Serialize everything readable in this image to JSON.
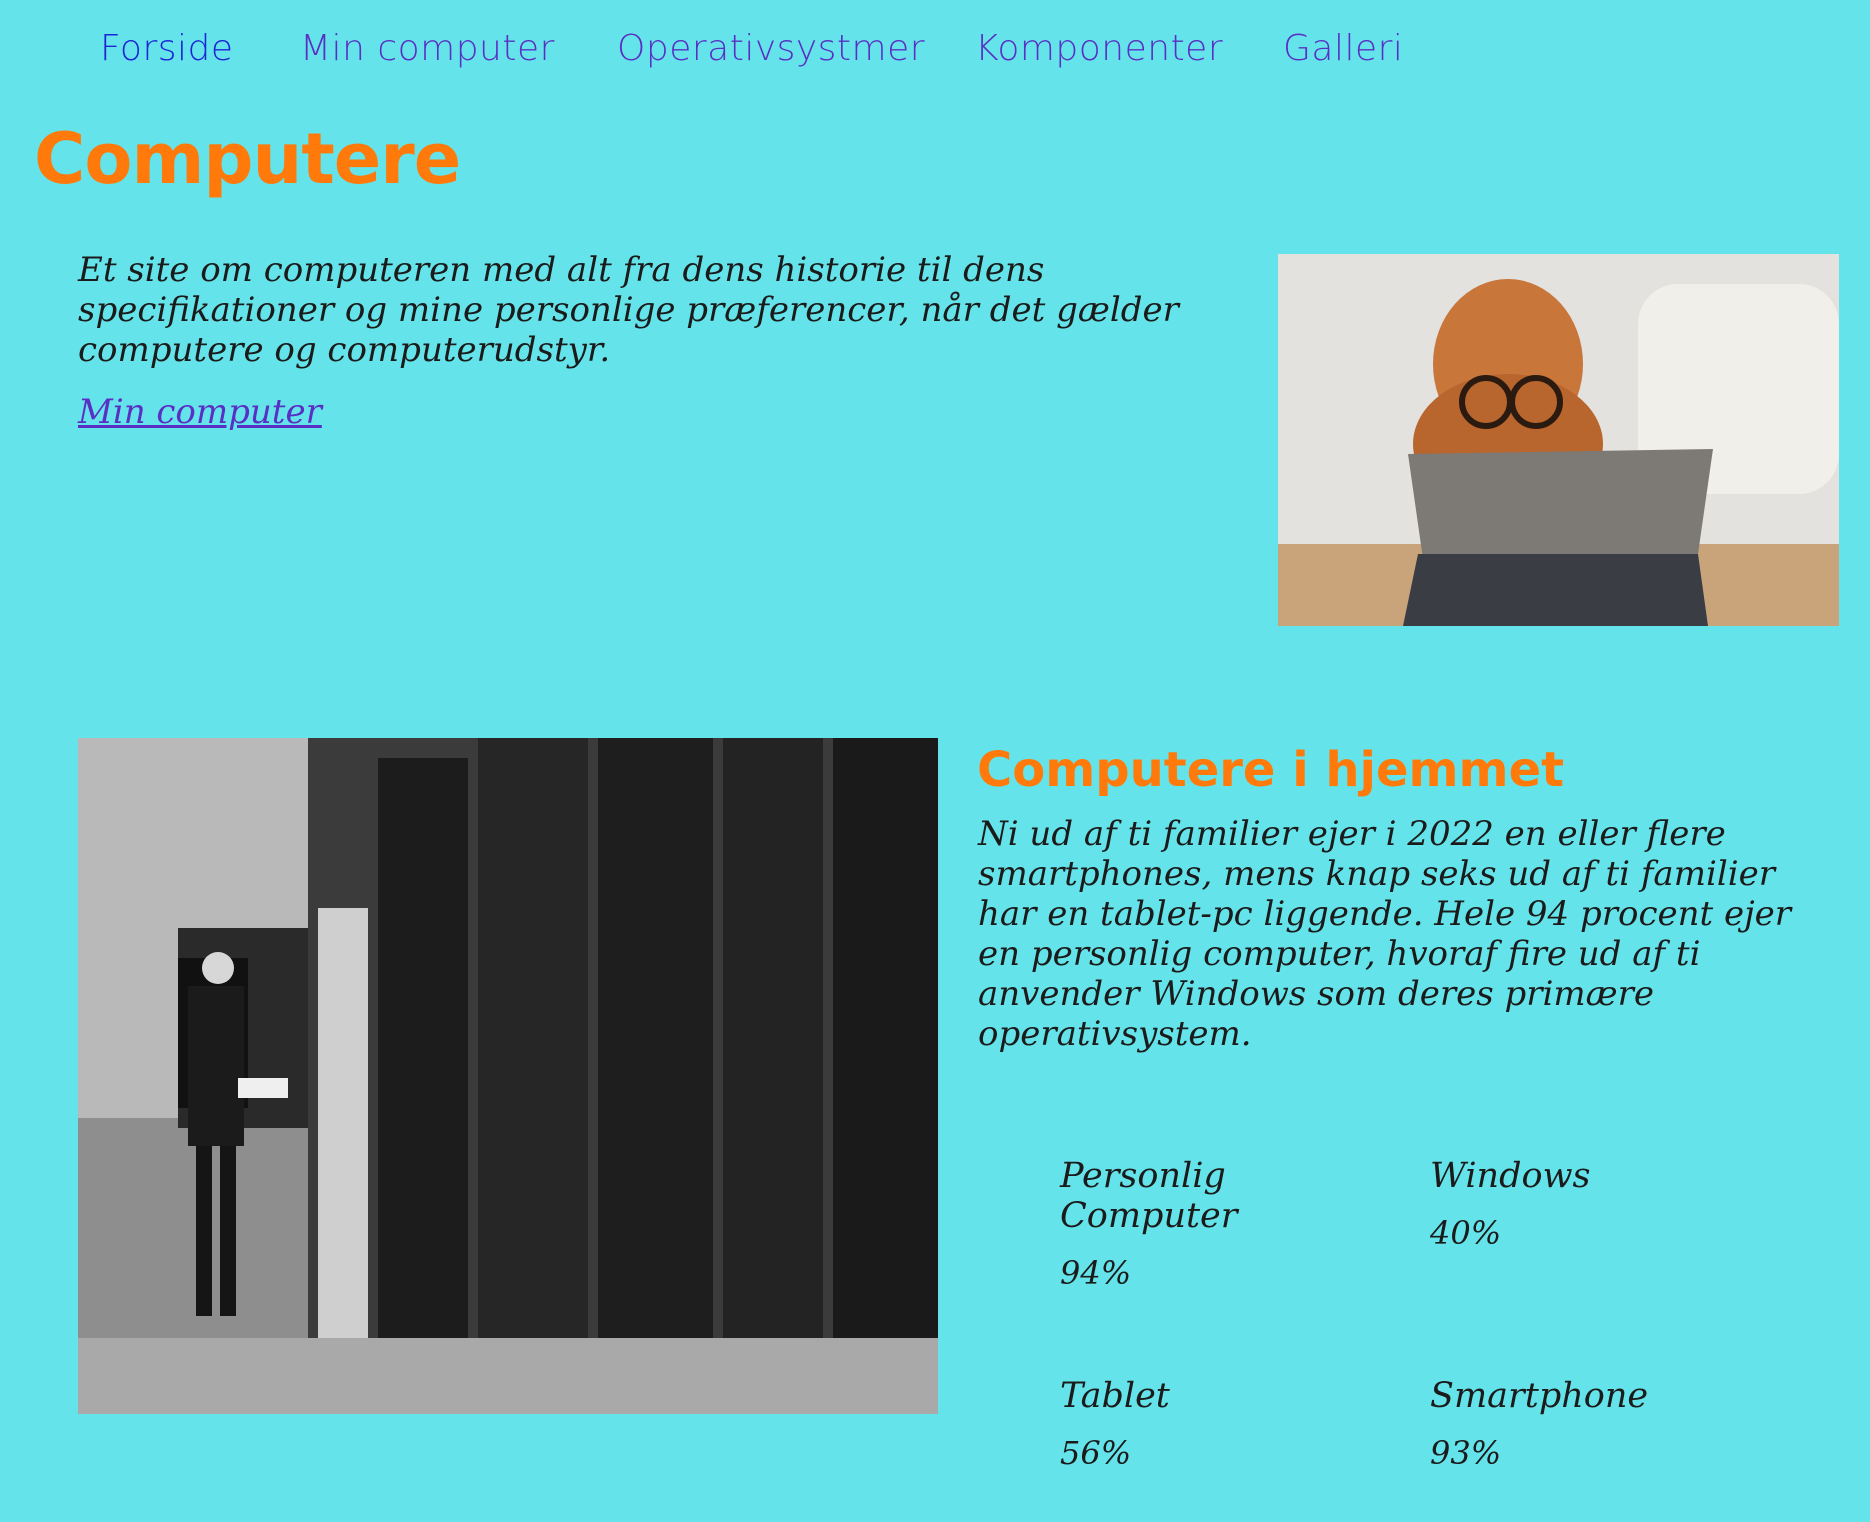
{
  "nav": {
    "items": [
      {
        "label": "Forside"
      },
      {
        "label": "Min computer"
      },
      {
        "label": "Operativsystmer"
      },
      {
        "label": "Komponenter"
      },
      {
        "label": "Galleri"
      }
    ]
  },
  "hero": {
    "title": "Computere",
    "intro": "Et site om computeren med alt fra dens historie til dens specifikationer og mine personlige præferencer, når det gælder computere og computerudstyr.",
    "link_label": "Min computer"
  },
  "home_section": {
    "title": "Computere i hjemmet",
    "text": "Ni ud af ti familier ejer i 2022 en eller flere smartphones, mens knap seks ud af ti familier har en tablet-pc liggende. Hele 94 procent ejer en personlig computer, hvoraf fire ud af ti anvender Windows som deres primære operativsystem.",
    "stats": [
      {
        "label": "Personlig Computer",
        "value": "94%"
      },
      {
        "label": "Windows",
        "value": "40%"
      },
      {
        "label": "Tablet",
        "value": "56%"
      },
      {
        "label": "Smartphone",
        "value": "93%"
      }
    ]
  },
  "colors": {
    "background": "#64e4ea",
    "heading": "#ff7a0a",
    "nav_active": "#1d25d6",
    "link": "#5a2fc4"
  }
}
